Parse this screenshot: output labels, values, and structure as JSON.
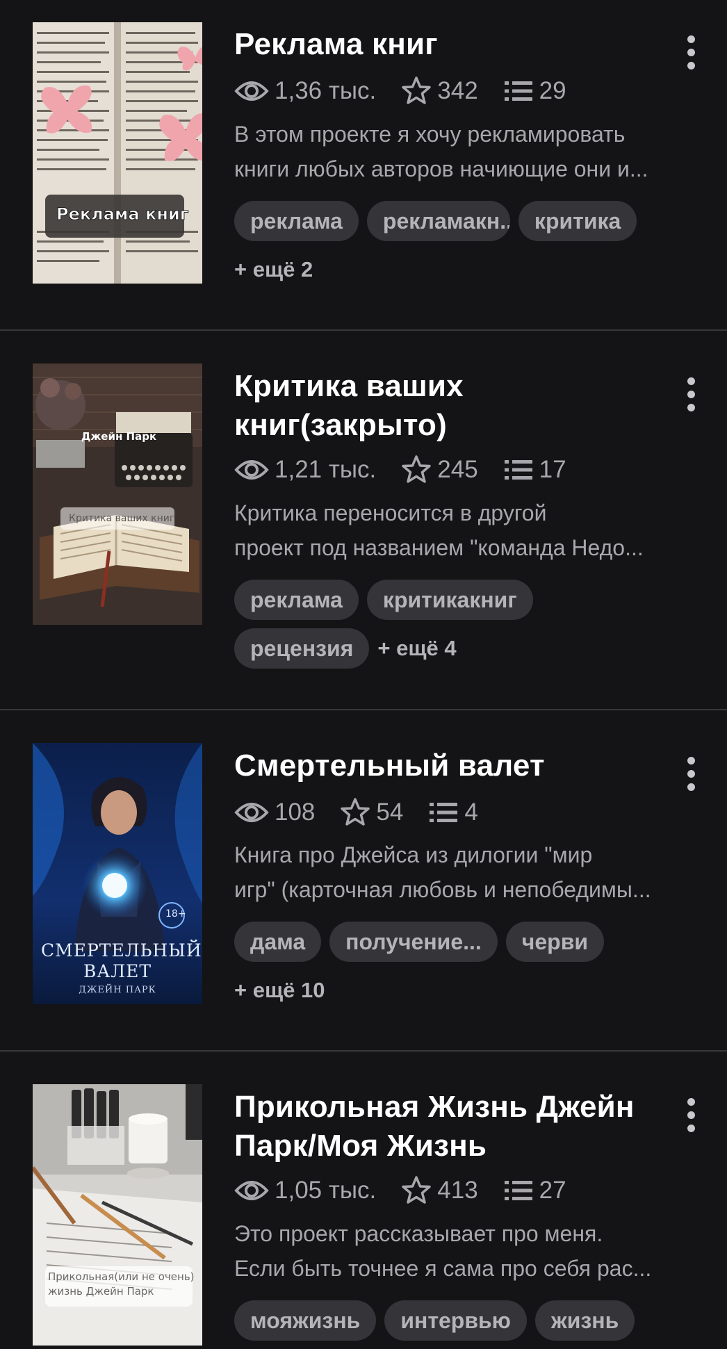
{
  "stories": [
    {
      "title_lines": [
        "Реклама книг"
      ],
      "views": "1,36 тыс.",
      "votes": "342",
      "parts": "29",
      "description_lines": [
        "В этом проекте я хочу рекламировать",
        "книги любых авторов начиющие они и..."
      ],
      "tags": [
        "реклама",
        "рекламакн...",
        "критика"
      ],
      "more_tags": "+ ещё 2",
      "cover_text": [
        "Реклама книг"
      ]
    },
    {
      "title_lines": [
        "Критика ваших",
        "книг(закрыто)"
      ],
      "views": "1,21 тыс.",
      "votes": "245",
      "parts": "17",
      "description_lines": [
        "Критика переносится в другой",
        "проект под названием \"команда Недо..."
      ],
      "tags": [
        "реклама",
        "критикакниг",
        "рецензия"
      ],
      "more_tags": "+ ещё 4",
      "cover_text": [
        "Джейн Парк",
        "Критика ваших книг"
      ]
    },
    {
      "title_lines": [
        "Смертельный валет"
      ],
      "views": "108",
      "votes": "54",
      "parts": "4",
      "description_lines": [
        "Книга про Джейса из дилогии \"мир",
        "игр\" (карточная любовь и непобедимы..."
      ],
      "tags": [
        "дама",
        "получение...",
        "черви"
      ],
      "more_tags": "+ ещё 10",
      "cover_text": [
        "18+",
        "СМЕРТЕЛЬНЫЙ",
        "ВАЛЕТ",
        "ДЖЕЙН ПАРК"
      ]
    },
    {
      "title_lines": [
        "Прикольная Жизнь Джейн",
        "Парк/Моя Жизнь"
      ],
      "views": "1,05 тыс.",
      "votes": "413",
      "parts": "27",
      "description_lines": [
        "Это проект рассказывает про меня.",
        "Если быть точнее я сама про себя рас..."
      ],
      "tags": [
        "мояжизнь",
        "интервью",
        "жизнь"
      ],
      "more_tags": "",
      "cover_text": [
        "Прикольная(или не очень)",
        "жизнь Джейн Парк"
      ]
    }
  ],
  "icons": {
    "views": "eye-icon",
    "votes": "star-icon",
    "parts": "list-icon",
    "menu": "more-vertical-icon"
  },
  "colors": {
    "background": "#141315",
    "tag_background": "#353438",
    "secondary_text": "#a8a7ab"
  }
}
